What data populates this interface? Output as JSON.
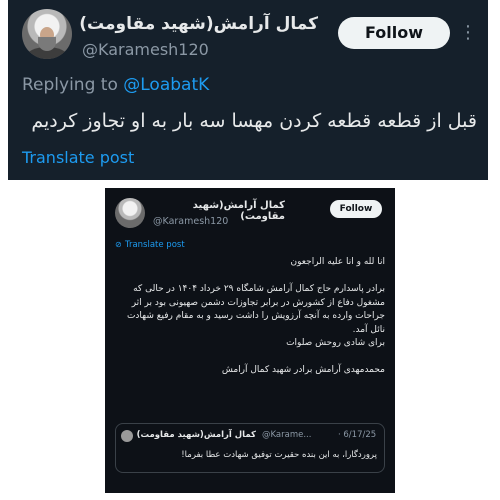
{
  "top_post": {
    "display_name": "کمال آرامش(شهید مقاومت)",
    "handle": "@Karamesh120",
    "follow_label": "Follow",
    "more_icon": "more-vertical-icon",
    "replying_prefix": "Replying to",
    "replying_to": "@LoabatK",
    "text": "قبل از قطعه قطعه کردن مهسا سه بار به او تجاوز کردیم",
    "translate_label": "Translate post"
  },
  "embedded_post": {
    "display_name": "کمال آرامش(شهید مقاومت)",
    "handle": "@Karamesh120",
    "follow_label": "Follow",
    "translate_label": "Translate post",
    "paragraphs": [
      "انا لله و انا علیه الراجعون",
      "",
      "برادر پاسدارم حاج کمال آرامش شامگاه ۲۹ خرداد ۱۴۰۴ در حالی که مشغول دفاع از کشورش در برابر تجاوزات دشمن صهیونی بود بر اثر جراحات وارده به آنچه آرزویش را داشت رسید و به مقام رفیع شهادت نائل آمد.",
      "برای شادی روحش صلوات",
      "",
      "محمدمهدی آرامش برادر شهید کمال آرامش"
    ],
    "quote": {
      "display_name": "کمال آرامش(شهید مقاومت)",
      "handle": "@Karame...",
      "date": "· 6/17/25",
      "text": "پروردگارا، به این بنده حقیرت توفیق شهادت عطا بفرما!"
    }
  },
  "colors": {
    "top_background": "#15202b",
    "bottom_background": "#0d1117",
    "link_blue": "#1d9bf0",
    "muted_text": "#8b98a5"
  }
}
